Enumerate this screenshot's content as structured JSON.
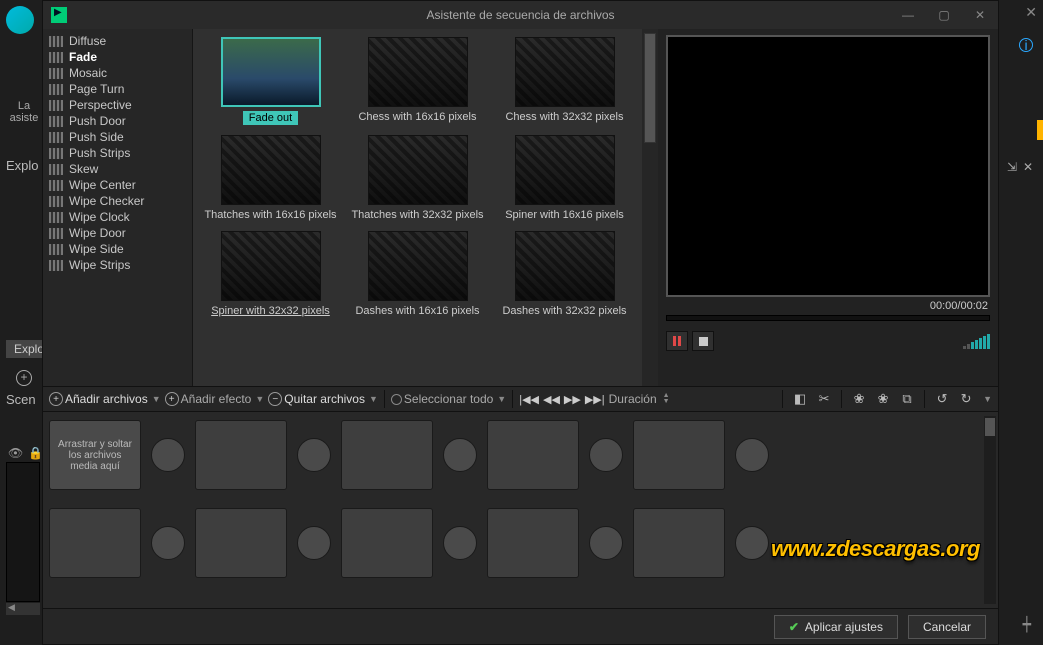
{
  "window": {
    "title": "Asistente de secuencia de archivos",
    "minimize": "—",
    "maximize": "▢",
    "close": "✕"
  },
  "backdrop": {
    "explorer": "Explo",
    "explorer_tab": "Explo",
    "scene": "Scen",
    "asist_line1": "La",
    "asist_line2": "asiste"
  },
  "tree": {
    "items": [
      {
        "label": "Diffuse",
        "selected": false
      },
      {
        "label": "Fade",
        "selected": true
      },
      {
        "label": "Mosaic",
        "selected": false
      },
      {
        "label": "Page Turn",
        "selected": false
      },
      {
        "label": "Perspective",
        "selected": false
      },
      {
        "label": "Push Door",
        "selected": false
      },
      {
        "label": "Push Side",
        "selected": false
      },
      {
        "label": "Push Strips",
        "selected": false
      },
      {
        "label": "Skew",
        "selected": false
      },
      {
        "label": "Wipe Center",
        "selected": false
      },
      {
        "label": "Wipe Checker",
        "selected": false
      },
      {
        "label": "Wipe Clock",
        "selected": false
      },
      {
        "label": "Wipe Door",
        "selected": false
      },
      {
        "label": "Wipe Side",
        "selected": false
      },
      {
        "label": "Wipe Strips",
        "selected": false
      }
    ]
  },
  "gallery": {
    "items": [
      {
        "label": "Fade out",
        "highlight": true,
        "color": true
      },
      {
        "label": "Chess with 16x16 pixels"
      },
      {
        "label": "Chess with 32x32 pixels"
      },
      {
        "label": "Thatches with 16x16 pixels"
      },
      {
        "label": "Thatches with 32x32 pixels"
      },
      {
        "label": "Spiner with 16x16 pixels"
      },
      {
        "label": "Spiner with 32x32 pixels",
        "underline": true
      },
      {
        "label": "Dashes with 16x16 pixels"
      },
      {
        "label": "Dashes with 32x32 pixels"
      }
    ]
  },
  "preview": {
    "timecode": "00:00/00:02"
  },
  "toolbar": {
    "add_files": "Añadir archivos",
    "add_effect": "Añadir efecto",
    "remove_files": "Quitar archivos",
    "select_all": "Seleccionar todo",
    "duration": "Duración"
  },
  "storyboard": {
    "drop_hint": "Arrastrar y soltar los archivos media aquí"
  },
  "footer": {
    "apply": "Aplicar ajustes",
    "cancel": "Cancelar"
  },
  "watermark": "www.zdescargas.org"
}
